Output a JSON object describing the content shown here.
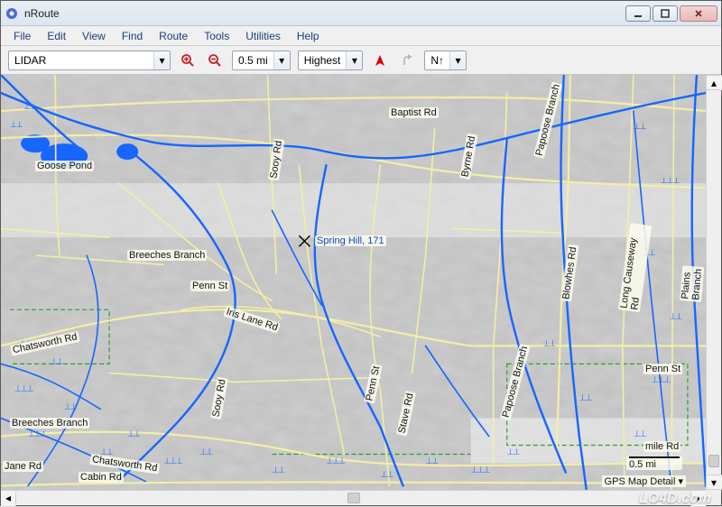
{
  "window": {
    "title": "nRoute"
  },
  "menu": [
    "File",
    "Edit",
    "View",
    "Find",
    "Route",
    "Tools",
    "Utilities",
    "Help"
  ],
  "toolbar": {
    "map_source": "LIDAR",
    "zoom_level": "0.5 mi",
    "detail_level": "Highest",
    "north_label": "N↑"
  },
  "map": {
    "center_label": "Spring Hill, 171",
    "scale_label": "0.5 mi",
    "status_label": "GPS Map Detail",
    "labels": {
      "baptist_rd": "Baptist Rd",
      "goose_pond": "Goose Pond",
      "breeches_branch": "Breeches Branch",
      "breeches_branch_2": "Breeches Branch",
      "penn_st": "Penn St",
      "penn_st_2": "Penn St",
      "penn_st_3": "Penn St",
      "papoose_branch_1": "Papoose Branch",
      "papoose_branch_2": "Papoose Branch",
      "long_causeway_rd": "Long Causeway Rd",
      "plains_branch": "Plains Branch",
      "chatsworth_rd": "Chatsworth Rd",
      "chatsworth_rd_2": "Chatsworth Rd",
      "blowhes_rd": "Blowhes Rd",
      "cabin_rd": "Cabin Rd",
      "sooy_rd": "Sooy Rd",
      "sooy_rd_2": "Sooy Rd",
      "iris_lane_rd": "Iris Lane Rd",
      "byrne_rd": "Byrne Rd",
      "stave_rd": "Stave Rd",
      "mile_rd": "mile Rd",
      "jane_rd": "Jane Rd"
    }
  },
  "watermark": "LO4D.com",
  "icons": {
    "zoom_in": "zoom-in-icon",
    "zoom_out": "zoom-out-icon",
    "heading": "heading-icon",
    "turn": "turn-icon",
    "north": "north-icon"
  }
}
